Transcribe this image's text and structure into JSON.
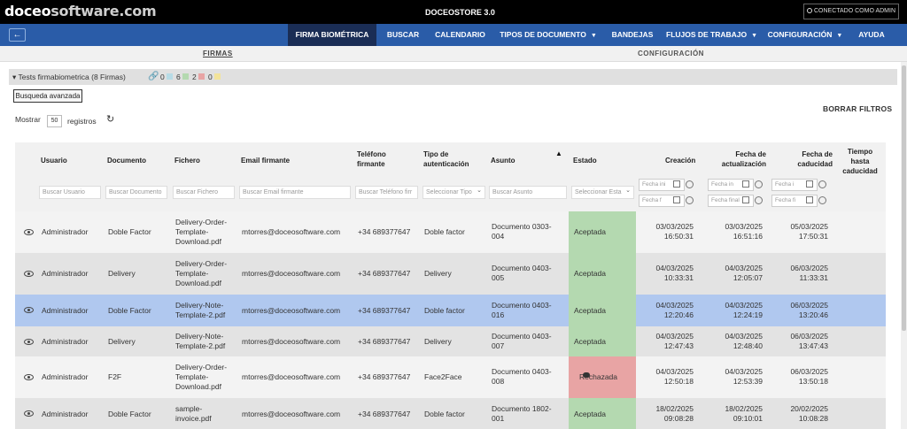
{
  "topbar": {
    "brand_prefix": "doceo",
    "brand_suffix": "software.com",
    "store": "DOCEOSTORE 3.0",
    "connected": "CONECTADO COMO ADMIN"
  },
  "nav": {
    "back_icon": "arrow-left-icon",
    "items": [
      "FIRMA BIOMÉTRICA",
      "BUSCAR",
      "CALENDARIO",
      "TIPOS DE DOCUMENTO",
      "BANDEJAS",
      "FLUJOS DE TRABAJO",
      "CONFIGURACIÓN",
      "AYUDA"
    ],
    "active": "FIRMA BIOMÉTRICA",
    "color": "#2a5ca8",
    "active_color": "#1a2d55"
  },
  "subtabs": [
    "FIRMAS",
    "CONFIGURACIÓN"
  ],
  "tests": {
    "title": "▾ Tests firmabiometrica (8 Firmas)",
    "counts": [
      {
        "value": "0",
        "color": "#b7dbe6"
      },
      {
        "value": "6",
        "color": "#b4d9b0"
      },
      {
        "value": "2",
        "color": "#e8a4a4"
      },
      {
        "value": "0",
        "color": "#f2e39a"
      }
    ]
  },
  "advanced_search": "Busqueda avanzada",
  "controls": {
    "show_label": "Mostrar",
    "show_value": "50",
    "records_label": "registros",
    "clear_filters": "BORRAR FILTROS"
  },
  "table": {
    "headers": {
      "usuario": "Usuario",
      "documento": "Documento",
      "fichero": "Fichero",
      "email": "Email firmante",
      "telefono": "Teléfono\nfirmante",
      "tipo": "Tipo de\nautenticación",
      "asunto": "Asunto",
      "estado": "Estado",
      "creacion": "Creación",
      "actualizacion": "Fecha de\nactualización",
      "caducidad": "Fecha de\ncaducidad",
      "tiempo": "Tiempo\nhasta\ncaducidad"
    },
    "filters": {
      "usuario": "Buscar Usuario",
      "documento": "Buscar Documento",
      "fichero": "Buscar Fichero",
      "email": "Buscar Email firmante",
      "telefono": "Buscar Teléfono firr",
      "tipo": "Seleccionar Tipo",
      "asunto": "Buscar Asunto",
      "estado": "Seleccionar Esta",
      "c_ini": "Fecha ini",
      "c_fin": "Fecha f",
      "a_ini": "Fecha in",
      "a_fin": "Fecha final",
      "k_ini": "Fecha i",
      "k_fin": "Fecha fi"
    },
    "rows": [
      {
        "usuario": "Administrador",
        "documento": "Doble Factor",
        "fichero": "Delivery-Order-\nTemplate-\nDownload.pdf",
        "email": "mtorres@doceosoftware.com",
        "telefono": "+34 689377647",
        "tipo": "Doble factor",
        "asunto": "Documento 0303-\n004",
        "estado": "Aceptada",
        "creacion": "03/03/2025\n16:50:31",
        "actualizacion": "03/03/2025\n16:51:16",
        "caducidad": "05/03/2025\n17:50:31"
      },
      {
        "usuario": "Administrador",
        "documento": "Delivery",
        "fichero": "Delivery-Order-\nTemplate-\nDownload.pdf",
        "email": "mtorres@doceosoftware.com",
        "telefono": "+34 689377647",
        "tipo": "Delivery",
        "asunto": "Documento 0403-\n005",
        "estado": "Aceptada",
        "creacion": "04/03/2025\n10:33:31",
        "actualizacion": "04/03/2025\n12:05:07",
        "caducidad": "06/03/2025\n11:33:31"
      },
      {
        "usuario": "Administrador",
        "documento": "Doble Factor",
        "fichero": "Delivery-Note-\nTemplate-2.pdf",
        "email": "mtorres@doceosoftware.com",
        "telefono": "+34 689377647",
        "tipo": "Doble factor",
        "asunto": "Documento 0403-\n016",
        "estado": "Aceptada",
        "creacion": "04/03/2025\n12:20:46",
        "actualizacion": "04/03/2025\n12:24:19",
        "caducidad": "06/03/2025\n13:20:46"
      },
      {
        "usuario": "Administrador",
        "documento": "Delivery",
        "fichero": "Delivery-Note-\nTemplate-2.pdf",
        "email": "mtorres@doceosoftware.com",
        "telefono": "+34 689377647",
        "tipo": "Delivery",
        "asunto": "Documento 0403-\n007",
        "estado": "Aceptada",
        "creacion": "04/03/2025\n12:47:43",
        "actualizacion": "04/03/2025\n12:48:40",
        "caducidad": "06/03/2025\n13:47:43"
      },
      {
        "usuario": "Administrador",
        "documento": "F2F",
        "fichero": "Delivery-Order-\nTemplate-\nDownload.pdf",
        "email": "mtorres@doceosoftware.com",
        "telefono": "+34 689377647",
        "tipo": "Face2Face",
        "asunto": "Documento 0403-\n008",
        "estado": "Rechazada",
        "creacion": "04/03/2025\n12:50:18",
        "actualizacion": "04/03/2025\n12:53:39",
        "caducidad": "06/03/2025\n13:50:18"
      },
      {
        "usuario": "Administrador",
        "documento": "Doble Factor",
        "fichero": "sample-\ninvoice.pdf",
        "email": "mtorres@doceosoftware.com",
        "telefono": "+34 689377647",
        "tipo": "Doble factor",
        "asunto": "Documento 1802-\n001",
        "estado": "Aceptada",
        "creacion": "18/02/2025\n09:08:28",
        "actualizacion": "18/02/2025\n09:10:01",
        "caducidad": "20/02/2025\n10:08:28"
      }
    ]
  }
}
